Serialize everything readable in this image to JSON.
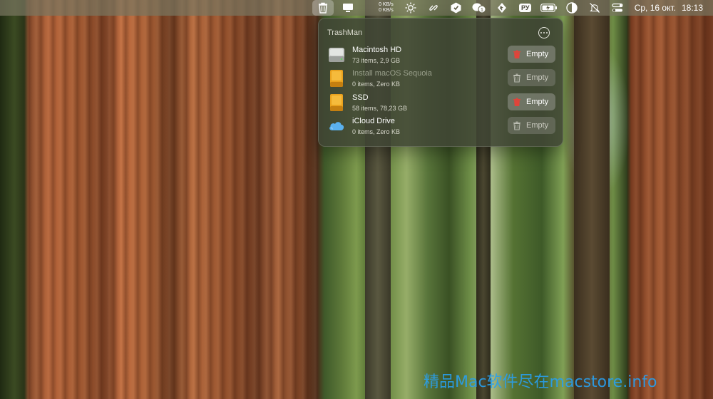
{
  "menubar": {
    "net_up": "0 KB/s",
    "net_down": "0 KB/s",
    "keyboard_layout": "РУ",
    "date": "Ср, 16 окт.",
    "time": "18:13",
    "icons": [
      "trash-icon",
      "display-icon",
      "network-speed",
      "brightness-icon",
      "link-icon",
      "app-icon",
      "wechat-icon",
      "cursor-icon",
      "keyboard-layout",
      "battery-icon",
      "appearance-icon",
      "do-not-disturb-icon",
      "control-center-icon"
    ],
    "wechat_badge": "1"
  },
  "trashman": {
    "title": "TrashMan",
    "volumes": [
      {
        "name": "Macintosh HD",
        "details": "73 items, 2,9 GB",
        "button": "Empty",
        "enabled": true,
        "icon": "internal-disk-icon"
      },
      {
        "name": "Install macOS Sequoia",
        "details": "0 items, Zero KB",
        "button": "Empty",
        "enabled": false,
        "icon": "external-disk-icon"
      },
      {
        "name": "SSD",
        "details": "58 items, 78,23 GB",
        "button": "Empty",
        "enabled": true,
        "icon": "external-disk-icon"
      },
      {
        "name": "iCloud Drive",
        "details": "0 items, Zero KB",
        "button": "Empty",
        "enabled": false,
        "icon": "icloud-icon"
      }
    ]
  },
  "watermark": "精品Mac软件尽在macstore.info",
  "colors": {
    "trash_enabled": "#e0443a",
    "trash_disabled": "#b9bbb0",
    "disk_orange": "#f0a020",
    "icloud_blue": "#5ab0ee"
  }
}
